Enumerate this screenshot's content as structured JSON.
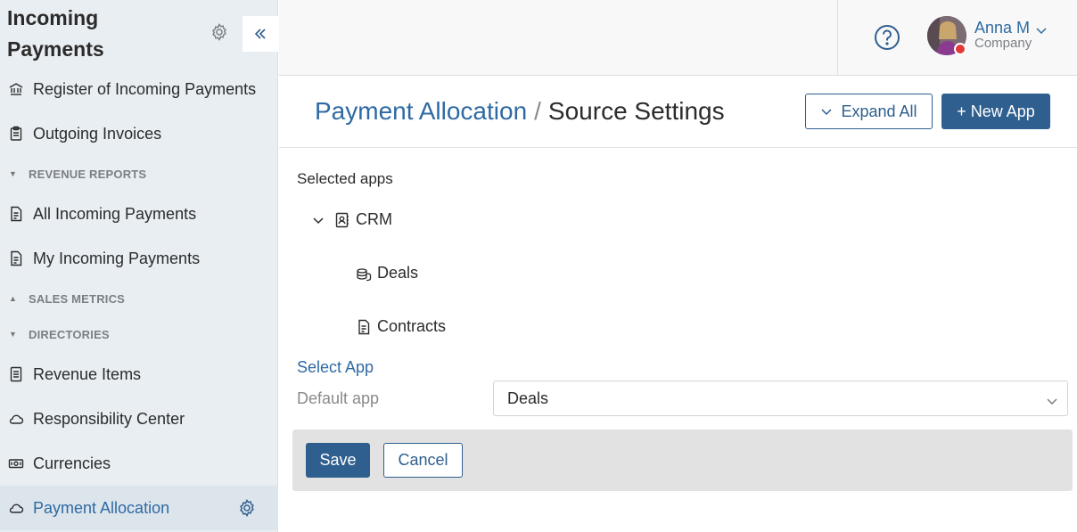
{
  "app": {
    "title_line1": "Incoming",
    "title_line2": "Payments"
  },
  "sidebar": {
    "items": [
      {
        "type": "item",
        "label": "Register of Incoming Payments",
        "icon": "bank-icon"
      },
      {
        "type": "item",
        "label": "Outgoing Invoices",
        "icon": "clipboard-icon"
      },
      {
        "type": "section",
        "label": "REVENUE REPORTS",
        "state": "expanded"
      },
      {
        "type": "item",
        "label": "All Incoming Payments",
        "icon": "document-icon"
      },
      {
        "type": "item",
        "label": "My Incoming Payments",
        "icon": "document-icon"
      },
      {
        "type": "section",
        "label": "SALES METRICS",
        "state": "collapsed"
      },
      {
        "type": "section",
        "label": "DIRECTORIES",
        "state": "expanded"
      },
      {
        "type": "item",
        "label": "Revenue Items",
        "icon": "list-icon"
      },
      {
        "type": "item",
        "label": "Responsibility Center",
        "icon": "cloud-icon"
      },
      {
        "type": "item",
        "label": "Currencies",
        "icon": "banknote-icon"
      },
      {
        "type": "item",
        "label": "Payment Allocation",
        "icon": "cloud-icon",
        "active": true
      }
    ]
  },
  "header": {
    "user": {
      "name": "Anna M",
      "company": "Company",
      "status_color": "#e23a3a"
    }
  },
  "page": {
    "breadcrumb_link": "Payment Allocation",
    "breadcrumb_sep": "/",
    "breadcrumb_current": "Source Settings",
    "expand_all_label": "Expand All",
    "new_app_label": "+ New App"
  },
  "content": {
    "selected_apps_label": "Selected apps",
    "tree": {
      "root": {
        "label": "CRM",
        "icon": "contact-book-icon",
        "expanded": true
      },
      "children": [
        {
          "label": "Deals",
          "icon": "coins-icon"
        },
        {
          "label": "Contracts",
          "icon": "document-icon"
        }
      ]
    },
    "select_app_label": "Select App",
    "default_app_label": "Default app",
    "default_app_value": "Deals",
    "save_label": "Save",
    "cancel_label": "Cancel"
  },
  "colors": {
    "accent": "#2f5f8f",
    "link": "#2f6aa3",
    "sidebar_bg": "#e9eef3"
  }
}
